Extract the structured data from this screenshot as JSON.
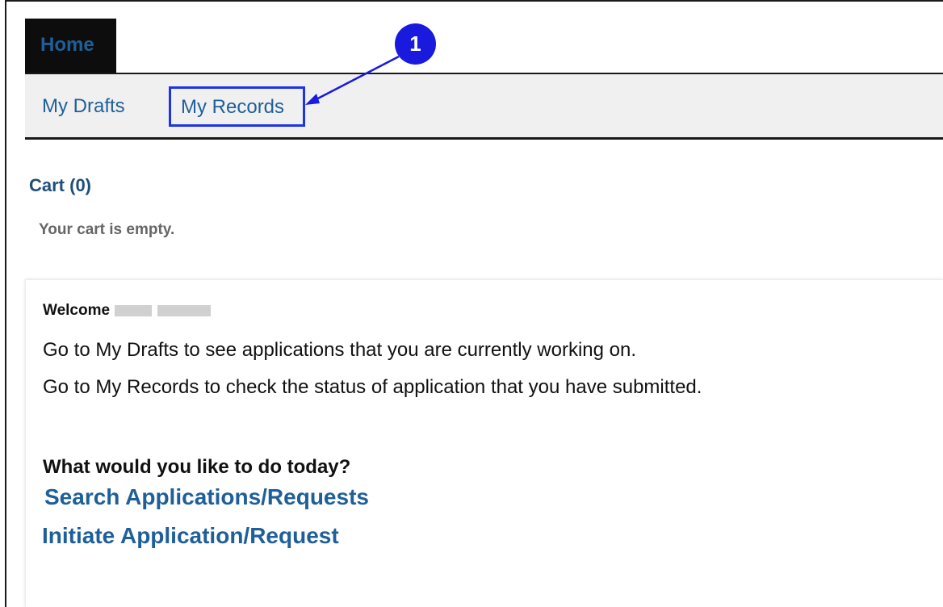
{
  "tabs": {
    "home_label": "Home"
  },
  "subnav": {
    "drafts_label": "My Drafts",
    "records_label": "My Records"
  },
  "callout": {
    "number": "1"
  },
  "cart": {
    "title": "Cart (0)",
    "empty_message": "Your cart is empty."
  },
  "welcome": {
    "greeting": "Welcome",
    "line1": "Go to My Drafts to see applications that you are currently working on.",
    "line2": "Go to My Records to check the status of application that you have submitted."
  },
  "actions": {
    "question": "What would you like to do today?",
    "search_label": "Search Applications/Requests",
    "initiate_label": "Initiate Application/Request"
  },
  "colors": {
    "link": "#1f5f99",
    "callout": "#1a1adf",
    "highlight_box": "#1c34e6"
  }
}
